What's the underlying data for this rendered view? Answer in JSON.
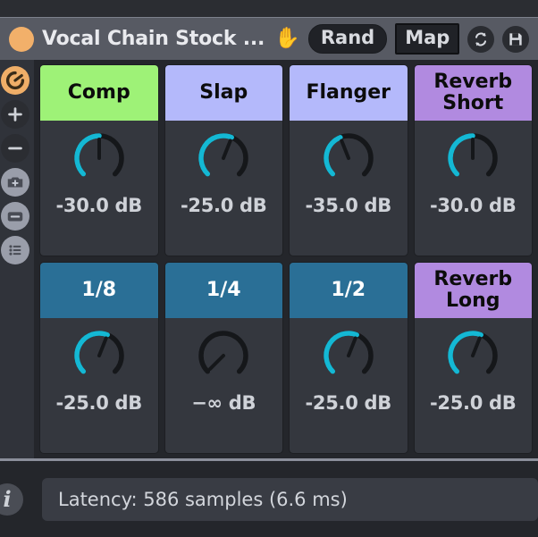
{
  "window": {
    "title": "Vocal Chain Stock ...",
    "status_dot_color": "#f2b06a",
    "hand_icon": "raised-hand-emoji",
    "rand_label": "Rand",
    "map_label": "Map",
    "sync_icon": "sync-arrows-icon",
    "save_icon": "floppy-save-icon"
  },
  "sidebar": {
    "items": [
      {
        "name": "power-knob-icon",
        "style": "power"
      },
      {
        "name": "plus-icon",
        "style": "dark"
      },
      {
        "name": "minus-icon",
        "style": "dark"
      },
      {
        "name": "snapshot-camera-icon",
        "style": "grey"
      },
      {
        "name": "remove-box-icon",
        "style": "grey"
      },
      {
        "name": "list-icon",
        "style": "grey"
      }
    ]
  },
  "chain": {
    "cells": [
      {
        "label": "Comp",
        "color": "#9ef277",
        "text_color": "#0c0c0c",
        "value": "-30.0 dB",
        "knob_pct": 0.5
      },
      {
        "label": "Slap",
        "color": "#b4b9fb",
        "text_color": "#0c0c0c",
        "value": "-25.0 dB",
        "knob_pct": 0.58
      },
      {
        "label": "Flanger",
        "color": "#b4b9fb",
        "text_color": "#0c0c0c",
        "value": "-35.0 dB",
        "knob_pct": 0.42
      },
      {
        "label": "Reverb\nShort",
        "color": "#b18ae0",
        "text_color": "#0c0c0c",
        "value": "-30.0 dB",
        "knob_pct": 0.5
      },
      {
        "label": "1/8",
        "color": "#2a6f96",
        "text_color": "#ffffff",
        "value": "-25.0 dB",
        "knob_pct": 0.58
      },
      {
        "label": "1/4",
        "color": "#2a6f96",
        "text_color": "#ffffff",
        "value": "−∞ dB",
        "knob_pct": 0.0
      },
      {
        "label": "1/2",
        "color": "#2a6f96",
        "text_color": "#ffffff",
        "value": "-25.0 dB",
        "knob_pct": 0.58
      },
      {
        "label": "Reverb\nLong",
        "color": "#b18ae0",
        "text_color": "#0c0c0c",
        "value": "-25.0 dB",
        "knob_pct": 0.58
      }
    ],
    "knob_arc_color": "#14b8d4",
    "knob_ring_color": "#15171a"
  },
  "footer": {
    "info_icon": "info-icon",
    "info_glyph": "i",
    "latency_text": "Latency: 586 samples (6.6 ms)"
  }
}
